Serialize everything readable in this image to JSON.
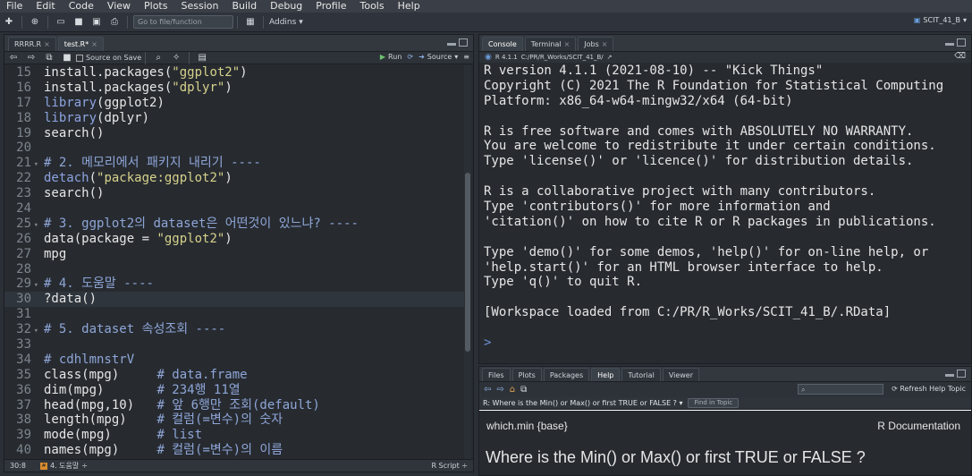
{
  "menu": [
    "File",
    "Edit",
    "Code",
    "View",
    "Plots",
    "Session",
    "Build",
    "Debug",
    "Profile",
    "Tools",
    "Help"
  ],
  "toolbar": {
    "goto_placeholder": "Go to file/function",
    "addins_label": "Addins",
    "project_label": "SCIT_41_B"
  },
  "editor": {
    "tabs": [
      {
        "label": "RRRR.R",
        "active": false
      },
      {
        "label": "test.R*",
        "active": true
      }
    ],
    "source_on_save": "Source on Save",
    "run_label": "Run",
    "source_label": "Source",
    "cursor_pos": "30:8",
    "function_scope": "4. 도움말",
    "file_type": "R Script",
    "lines": [
      {
        "n": "15",
        "fold": "",
        "parts": [
          [
            "txt",
            "install.packages("
          ],
          [
            "str",
            "\"ggplot2\""
          ],
          [
            "txt",
            ")"
          ]
        ]
      },
      {
        "n": "16",
        "fold": "",
        "parts": [
          [
            "txt",
            "install.packages("
          ],
          [
            "str",
            "\"dplyr\""
          ],
          [
            "txt",
            ")"
          ]
        ]
      },
      {
        "n": "17",
        "fold": "",
        "parts": [
          [
            "kw",
            "library"
          ],
          [
            "txt",
            "(ggplot2)"
          ]
        ]
      },
      {
        "n": "18",
        "fold": "",
        "parts": [
          [
            "kw",
            "library"
          ],
          [
            "txt",
            "(dplyr)"
          ]
        ]
      },
      {
        "n": "19",
        "fold": "",
        "parts": [
          [
            "txt",
            "search()"
          ]
        ]
      },
      {
        "n": "20",
        "fold": "",
        "parts": [
          [
            "txt",
            ""
          ]
        ]
      },
      {
        "n": "21",
        "fold": "▾",
        "parts": [
          [
            "cm",
            "# 2. 메모리에서 패키지 내리기 ----"
          ]
        ]
      },
      {
        "n": "22",
        "fold": "",
        "parts": [
          [
            "kw",
            "detach"
          ],
          [
            "txt",
            "("
          ],
          [
            "str",
            "\"package:ggplot2\""
          ],
          [
            "txt",
            ")"
          ]
        ]
      },
      {
        "n": "23",
        "fold": "",
        "parts": [
          [
            "txt",
            "search()"
          ]
        ]
      },
      {
        "n": "24",
        "fold": "",
        "parts": [
          [
            "txt",
            ""
          ]
        ]
      },
      {
        "n": "25",
        "fold": "▾",
        "parts": [
          [
            "cm",
            "# 3. ggplot2의 dataset은 어떤것이 있느냐? ----"
          ]
        ]
      },
      {
        "n": "26",
        "fold": "",
        "parts": [
          [
            "txt",
            "data(package = "
          ],
          [
            "str",
            "\"ggplot2\""
          ],
          [
            "txt",
            ")"
          ]
        ]
      },
      {
        "n": "27",
        "fold": "",
        "parts": [
          [
            "txt",
            "mpg"
          ]
        ]
      },
      {
        "n": "28",
        "fold": "",
        "parts": [
          [
            "txt",
            ""
          ]
        ]
      },
      {
        "n": "29",
        "fold": "▾",
        "parts": [
          [
            "cm",
            "# 4. 도움말 ----"
          ]
        ]
      },
      {
        "n": "30",
        "fold": "",
        "cur": true,
        "parts": [
          [
            "txt",
            "?data()"
          ]
        ]
      },
      {
        "n": "31",
        "fold": "",
        "parts": [
          [
            "txt",
            ""
          ]
        ]
      },
      {
        "n": "32",
        "fold": "▾",
        "parts": [
          [
            "cm",
            "# 5. dataset 속성조회 ----"
          ]
        ]
      },
      {
        "n": "33",
        "fold": "",
        "parts": [
          [
            "txt",
            ""
          ]
        ]
      },
      {
        "n": "34",
        "fold": "",
        "parts": [
          [
            "cm",
            "# cdhlmnstrV"
          ]
        ]
      },
      {
        "n": "35",
        "fold": "",
        "parts": [
          [
            "txt",
            "class(mpg)     "
          ],
          [
            "cm",
            "# data.frame"
          ]
        ]
      },
      {
        "n": "36",
        "fold": "",
        "parts": [
          [
            "txt",
            "dim(mpg)       "
          ],
          [
            "cm",
            "# 234행 11열"
          ]
        ]
      },
      {
        "n": "37",
        "fold": "",
        "parts": [
          [
            "txt",
            "head(mpg,10)   "
          ],
          [
            "cm",
            "# 앞 6행만 조회(default)"
          ]
        ]
      },
      {
        "n": "38",
        "fold": "",
        "parts": [
          [
            "txt",
            "length(mpg)    "
          ],
          [
            "cm",
            "# 컬럼(=변수)의 숫자"
          ]
        ]
      },
      {
        "n": "39",
        "fold": "",
        "parts": [
          [
            "txt",
            "mode(mpg)      "
          ],
          [
            "cm",
            "# list"
          ]
        ]
      },
      {
        "n": "40",
        "fold": "",
        "parts": [
          [
            "txt",
            "names(mpg)     "
          ],
          [
            "cm",
            "# 컬럼(=변수)의 이름"
          ]
        ]
      }
    ]
  },
  "console": {
    "tabs": [
      {
        "label": "Console",
        "active": true
      },
      {
        "label": "Terminal",
        "active": false
      },
      {
        "label": "Jobs",
        "active": false
      }
    ],
    "r_version": "R 4.1.1",
    "path": "C:/PR/R_Works/SCIT_41_B/",
    "lines": [
      "R version 4.1.1 (2021-08-10) -- \"Kick Things\"",
      "Copyright (C) 2021 The R Foundation for Statistical Computing",
      "Platform: x86_64-w64-mingw32/x64 (64-bit)",
      "",
      "R is free software and comes with ABSOLUTELY NO WARRANTY.",
      "You are welcome to redistribute it under certain conditions.",
      "Type 'license()' or 'licence()' for distribution details.",
      "",
      "R is a collaborative project with many contributors.",
      "Type 'contributors()' for more information and",
      "'citation()' on how to cite R or R packages in publications.",
      "",
      "Type 'demo()' for some demos, 'help()' for on-line help, or",
      "'help.start()' for an HTML browser interface to help.",
      "Type 'q()' to quit R.",
      "",
      "[Workspace loaded from C:/PR/R_Works/SCIT_41_B/.RData]",
      ""
    ],
    "prompt": ">"
  },
  "help": {
    "tabs": [
      {
        "label": "Files",
        "active": false
      },
      {
        "label": "Plots",
        "active": false
      },
      {
        "label": "Packages",
        "active": false
      },
      {
        "label": "Help",
        "active": true
      },
      {
        "label": "Tutorial",
        "active": false
      },
      {
        "label": "Viewer",
        "active": false
      }
    ],
    "refresh_label": "Refresh Help Topic",
    "topic": "R: Where is the Min() or Max() or first TRUE or FALSE ?",
    "find_in_topic": "Find in Topic",
    "doc_left": "which.min {base}",
    "doc_right": "R Documentation",
    "doc_title": "Where is the Min() or Max() or first TRUE or FALSE ?"
  }
}
